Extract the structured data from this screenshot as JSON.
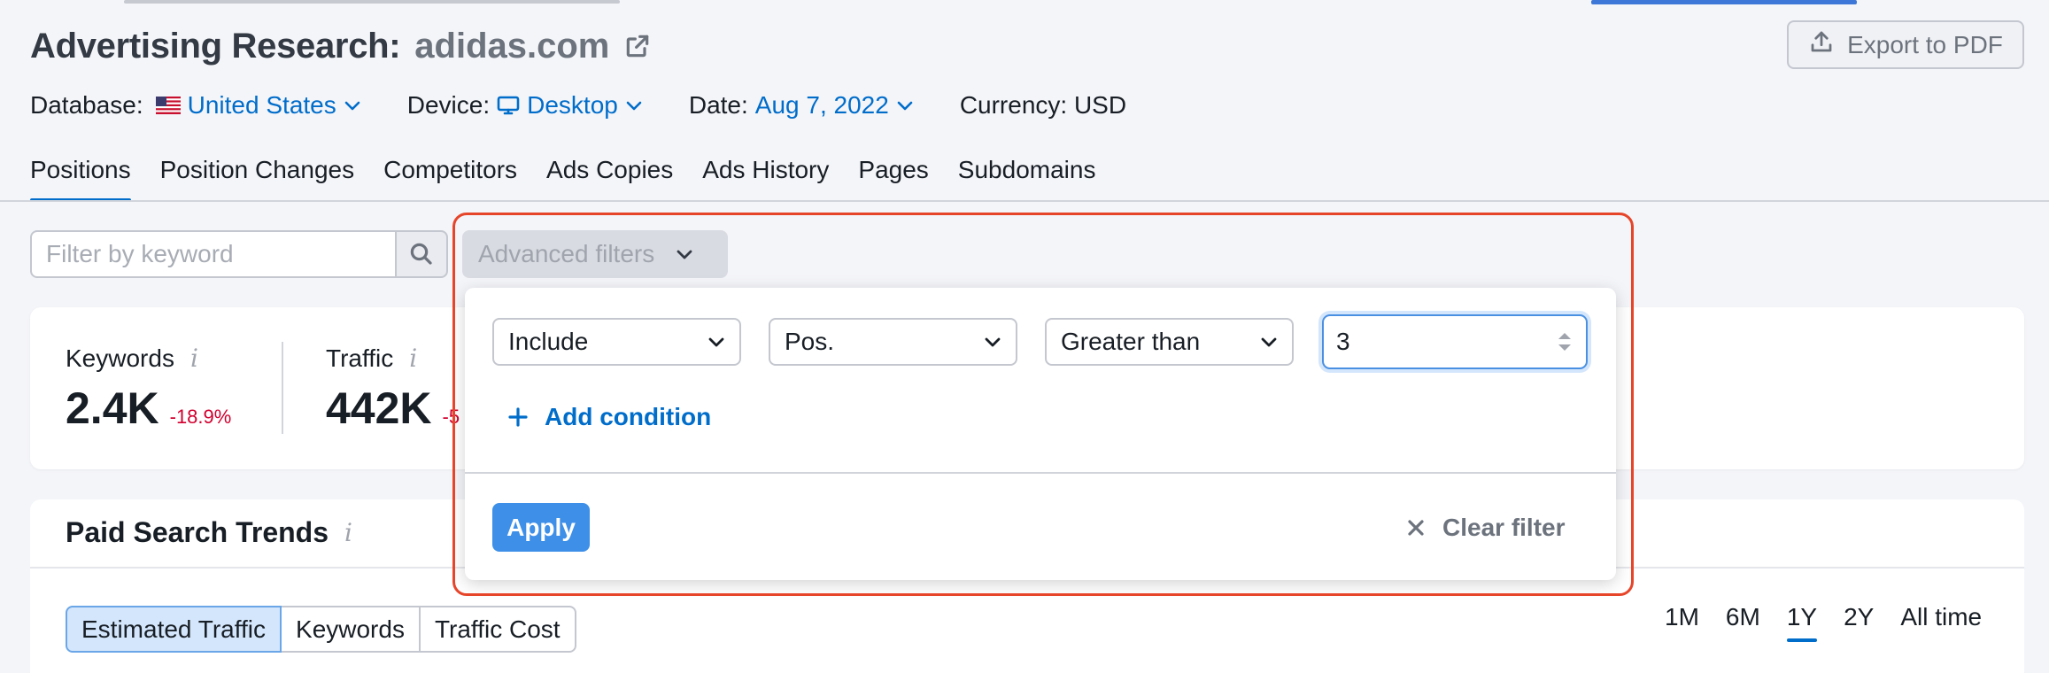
{
  "header": {
    "title": "Advertising Research:",
    "domain": "adidas.com",
    "export_label": "Export to PDF"
  },
  "meta": {
    "database_label": "Database:",
    "database_value": "United States",
    "device_label": "Device:",
    "device_value": "Desktop",
    "date_label": "Date:",
    "date_value": "Aug 7, 2022",
    "currency_label": "Currency: USD"
  },
  "tabs": [
    {
      "label": "Positions",
      "active": true
    },
    {
      "label": "Position Changes"
    },
    {
      "label": "Competitors"
    },
    {
      "label": "Ads Copies"
    },
    {
      "label": "Ads History"
    },
    {
      "label": "Pages"
    },
    {
      "label": "Subdomains"
    }
  ],
  "filter": {
    "keyword_placeholder": "Filter by keyword",
    "advanced_label": "Advanced filters"
  },
  "summary": {
    "keywords_label": "Keywords",
    "keywords_value": "2.4K",
    "keywords_delta": "-18.9%",
    "traffic_label": "Traffic",
    "traffic_value": "442K",
    "traffic_delta": "-5"
  },
  "trends": {
    "title": "Paid Search Trends",
    "segments": [
      "Estimated Traffic",
      "Keywords",
      "Traffic Cost"
    ],
    "periods": [
      "1M",
      "6M",
      "1Y",
      "2Y",
      "All time"
    ],
    "active_period": "1Y"
  },
  "advanced_panel": {
    "include_value": "Include",
    "field_value": "Pos.",
    "operator_value": "Greater than",
    "number_value": "3",
    "add_condition_label": "Add condition",
    "apply_label": "Apply",
    "clear_label": "Clear filter"
  },
  "colors": {
    "accent": "#006dca",
    "apply_bg": "#3d8fe8",
    "negative": "#d1002f",
    "highlight": "#e6452a"
  }
}
